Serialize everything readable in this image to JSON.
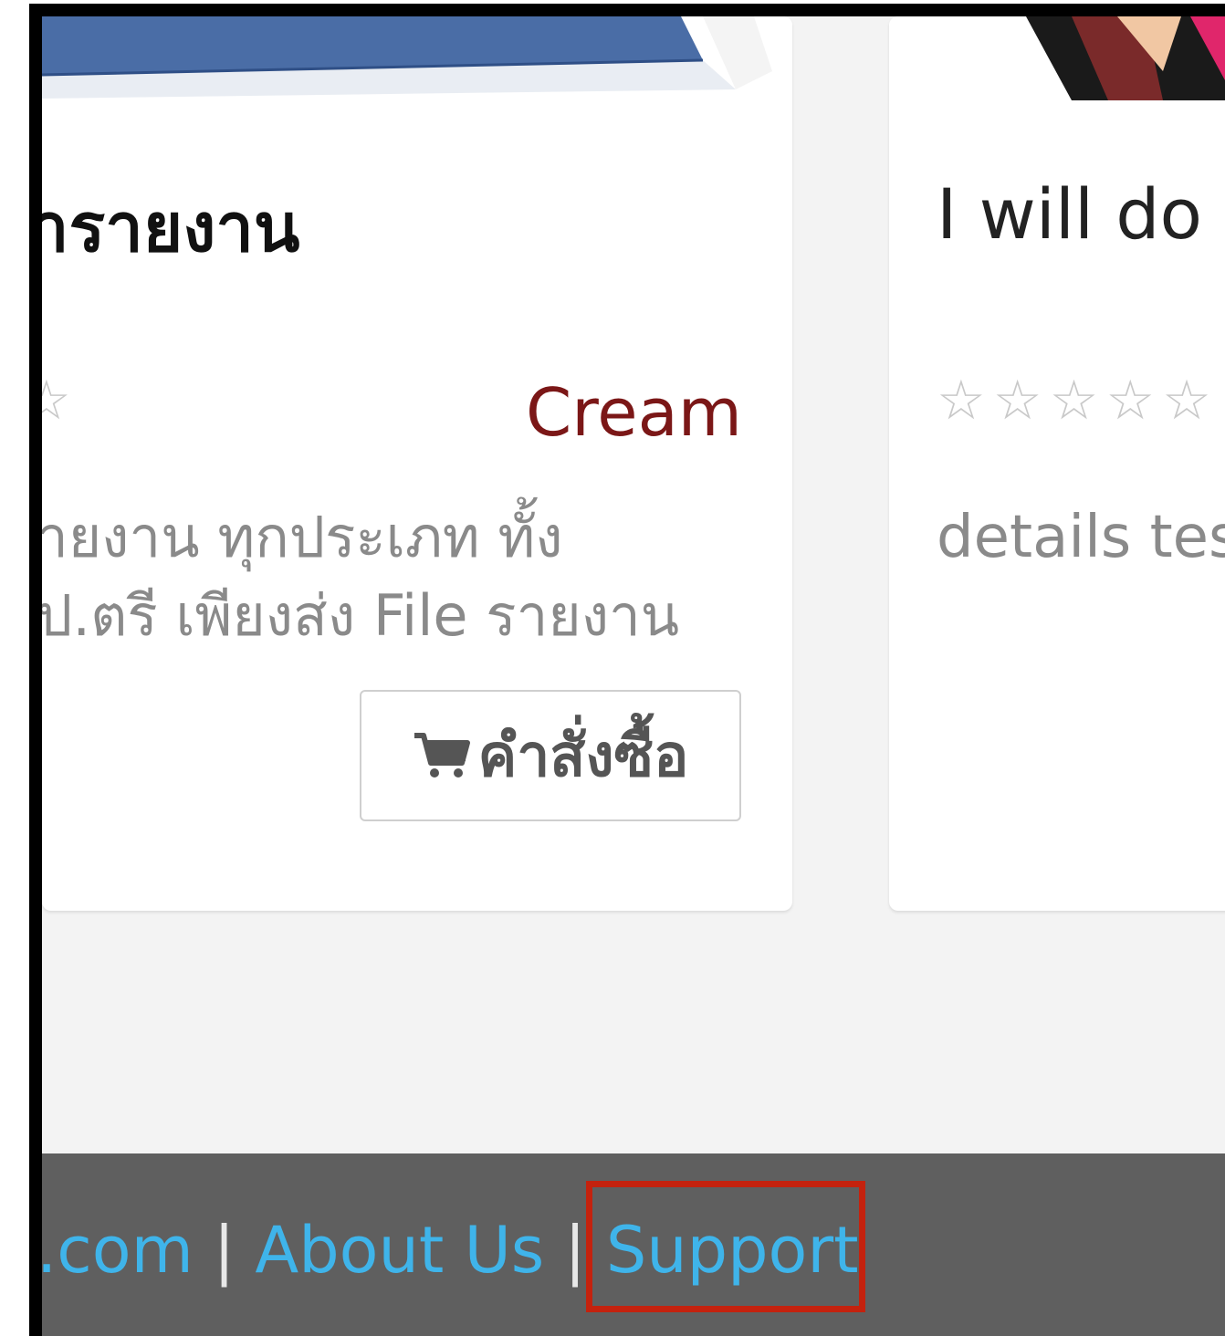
{
  "products": [
    {
      "title": "ารายงาน",
      "stars": "☆",
      "seller": "Cream",
      "description_lines": [
        "ายงาน ทุกประเภท ทั้ง",
        "ป.ตรี เพียงส่ง File รายงาน"
      ],
      "order_button": "คำสั่งซื้อ"
    },
    {
      "title": "I will do",
      "stars": "☆☆☆☆☆",
      "description_lines": [
        "details tes"
      ]
    }
  ],
  "footer": {
    "links": [
      ".com",
      "About Us",
      "Support"
    ],
    "separator": "|"
  },
  "colors": {
    "seller_text": "#7b1717",
    "footer_link": "#3fb4ea",
    "footer_bg": "#5f5f5f",
    "highlight_box": "#c4220e"
  },
  "icons": [
    "shopping-cart-icon",
    "star-outline-icon"
  ]
}
